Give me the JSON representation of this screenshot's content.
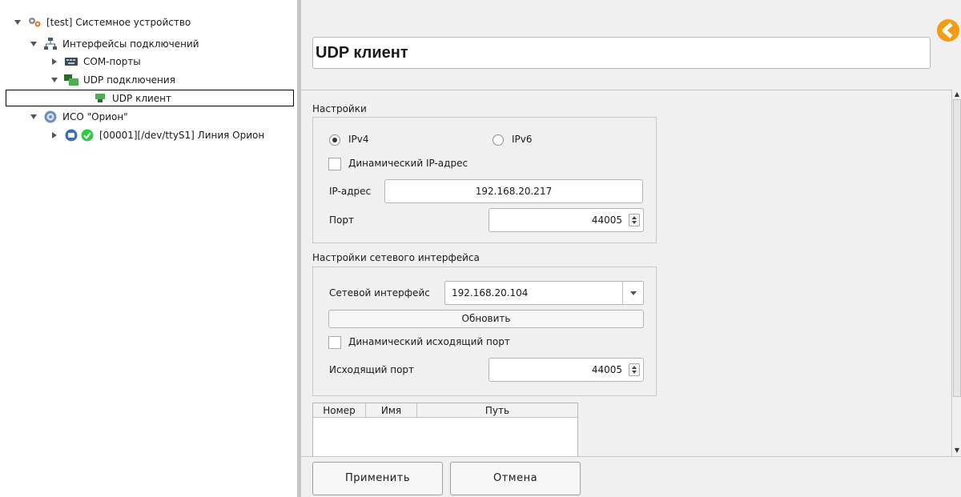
{
  "tree": {
    "root_label": "[test] Системное устройство",
    "interfaces_label": "Интерфейсы подключений",
    "com_label": "СОМ-порты",
    "udp_label": "UDP подключения",
    "udp_client_label": "UDP клиент",
    "iso_label": "ИСО \"Орион\"",
    "line_label": "[00001][/dev/ttyS1] Линия Орион"
  },
  "header": {
    "title": "UDP клиент"
  },
  "settings": {
    "section_label": "Настройки",
    "ipv4_label": "IPv4",
    "ipv6_label": "IPv6",
    "ip_version_selected": "IPv4",
    "dynamic_ip_label": "Динамический IP-адрес",
    "ip_label": "IP-адрес",
    "ip_value": "192.168.20.217",
    "port_label": "Порт",
    "port_value": "44005"
  },
  "network": {
    "section_label": "Настройки сетевого интерфейса",
    "interface_label": "Сетевой интерфейс",
    "interface_value": "192.168.20.104",
    "refresh_label": "Обновить",
    "dynamic_port_label": "Динамический исходящий порт",
    "out_port_label": "Исходящий порт",
    "out_port_value": "44005"
  },
  "table": {
    "columns": [
      "Номер",
      "Имя",
      "Путь"
    ]
  },
  "footer": {
    "apply_label": "Применить",
    "cancel_label": "Отмена"
  },
  "colors": {
    "accent_orange": "#f39c12",
    "status_green": "#2ecc40",
    "tree_udp_green": "#3aa03a"
  }
}
